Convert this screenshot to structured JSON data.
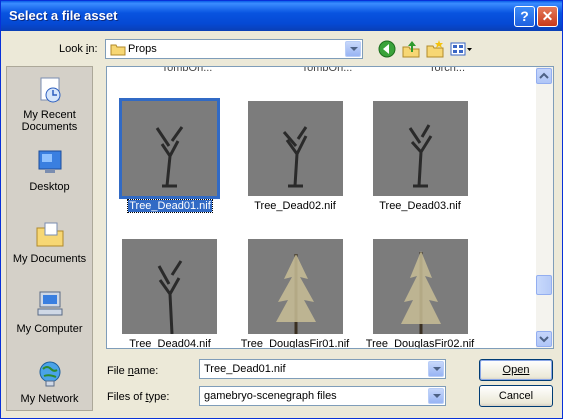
{
  "window": {
    "title": "Select a file asset",
    "help_glyph": "?",
    "close_glyph": "✕"
  },
  "lookin": {
    "label": "Look in:",
    "value": "Props"
  },
  "toolbar": {
    "back": "back-icon",
    "up": "up-folder-icon",
    "new_folder": "new-folder-icon",
    "views": "views-menu-icon"
  },
  "places": [
    {
      "label": "My Recent Documents",
      "icon": "recent-documents-icon"
    },
    {
      "label": "Desktop",
      "icon": "desktop-icon"
    },
    {
      "label": "My Documents",
      "icon": "my-documents-icon"
    },
    {
      "label": "My Computer",
      "icon": "my-computer-icon"
    },
    {
      "label": "My Network",
      "icon": "my-network-icon"
    }
  ],
  "files_partial_top": [
    "TombOn...",
    "TombOn...",
    "Torch..."
  ],
  "files": [
    {
      "name": "Tree_Dead01.nif",
      "selected": true
    },
    {
      "name": "Tree_Dead02.nif"
    },
    {
      "name": "Tree_Dead03.nif"
    },
    {
      "name": "Tree_Dead04.nif"
    },
    {
      "name": "Tree_DouglasFir01.nif"
    },
    {
      "name": "Tree_DouglasFir02.nif"
    }
  ],
  "filename": {
    "label": "File name:",
    "value": "Tree_Dead01.nif"
  },
  "filetype": {
    "label": "Files of type:",
    "value": "gamebryo-scenegraph files"
  },
  "buttons": {
    "open": "Open",
    "cancel": "Cancel"
  },
  "colors": {
    "titlebar": "#0854e0",
    "selection": "#316ac5",
    "face": "#ece9d8"
  }
}
